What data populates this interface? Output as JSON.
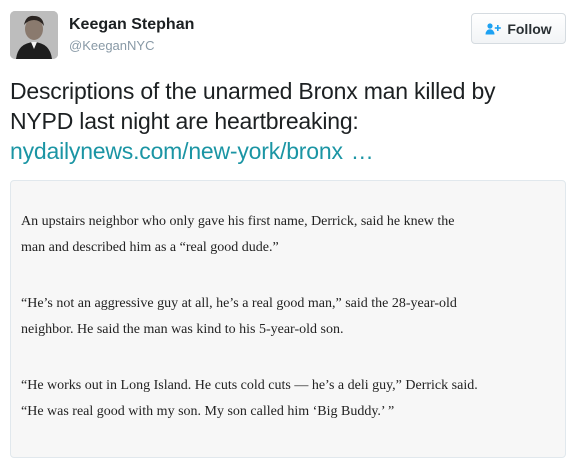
{
  "user": {
    "name": "Keegan Stephan",
    "handle": "@KeeganNYC",
    "avatar_icon": "user-photo"
  },
  "follow_button": {
    "label": "Follow",
    "icon": "add-user-icon",
    "icon_color": "#1da1f2"
  },
  "tweet": {
    "text_line_1": "Descriptions of the unarmed Bronx man killed by",
    "text_line_2": "NYPD last night are heartbreaking:",
    "link_text": "nydailynews.com/new-york/bronx",
    "link_ellipsis": "…",
    "link_color": "#1b95a4"
  },
  "image_text": {
    "paragraph_1_line_1": "An upstairs neighbor who only gave his first name, Derrick, said he knew the",
    "paragraph_1_line_2": "man and described him as a “real good dude.”",
    "paragraph_2_line_1": "“He’s not an aggressive guy at all, he’s a real good man,” said the 28-year-old",
    "paragraph_2_line_2": "neighbor. He said the man was kind to his 5-year-old son.",
    "paragraph_3_line_1": "“He works out in Long Island. He cuts cold cuts — he’s a deli guy,” Derrick said.",
    "paragraph_3_line_2": "“He was real good with my son. My son called him ‘Big Buddy.’ ”"
  }
}
